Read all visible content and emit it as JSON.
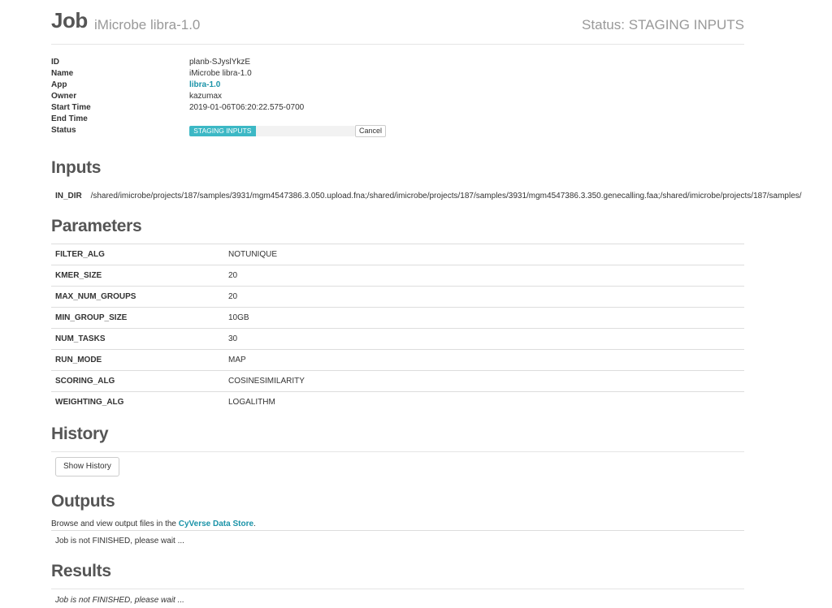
{
  "header": {
    "title": "Job",
    "subtitle": "iMicrobe libra-1.0",
    "status_text": "Status: STAGING INPUTS"
  },
  "info": [
    {
      "label": "ID",
      "value": "planb-SJyslYkzE"
    },
    {
      "label": "Name",
      "value": "iMicrobe libra-1.0"
    },
    {
      "label": "App",
      "value": "libra-1.0"
    },
    {
      "label": "Owner",
      "value": "kazumax"
    },
    {
      "label": "Start Time",
      "value": "2019-01-06T06:20:22.575-0700"
    },
    {
      "label": "End Time",
      "value": ""
    },
    {
      "label": "Status",
      "value": ""
    }
  ],
  "status_progress": {
    "label": "STAGING INPUTS",
    "fraction": 0.4,
    "cancel_label": "Cancel"
  },
  "inputs": {
    "title": "Inputs",
    "key": "IN_DIR",
    "value": "/shared/imicrobe/projects/187/samples/3931/mgm4547386.3.050.upload.fna;/shared/imicrobe/projects/187/samples/3931/mgm4547386.3.350.genecalling.faa;/shared/imicrobe/projects/187/samples/"
  },
  "parameters": {
    "title": "Parameters",
    "rows": [
      {
        "key": "FILTER_ALG",
        "value": "NOTUNIQUE"
      },
      {
        "key": "KMER_SIZE",
        "value": "20"
      },
      {
        "key": "MAX_NUM_GROUPS",
        "value": "20"
      },
      {
        "key": "MIN_GROUP_SIZE",
        "value": "10GB"
      },
      {
        "key": "NUM_TASKS",
        "value": "30"
      },
      {
        "key": "RUN_MODE",
        "value": "MAP"
      },
      {
        "key": "SCORING_ALG",
        "value": "COSINESIMILARITY"
      },
      {
        "key": "WEIGHTING_ALG",
        "value": "LOGALITHM"
      }
    ]
  },
  "history": {
    "title": "History",
    "button_label": "Show History"
  },
  "outputs": {
    "title": "Outputs",
    "desc_prefix": "Browse and view output files in the ",
    "link_label": "CyVerse Data Store",
    "desc_suffix": ".",
    "wait_text": "Job is not FINISHED, please wait ..."
  },
  "results": {
    "title": "Results",
    "wait_text": "Job is not FINISHED, please wait ..."
  },
  "colors": {
    "accent": "#1a93a8",
    "progress": "#3cb8c5"
  }
}
